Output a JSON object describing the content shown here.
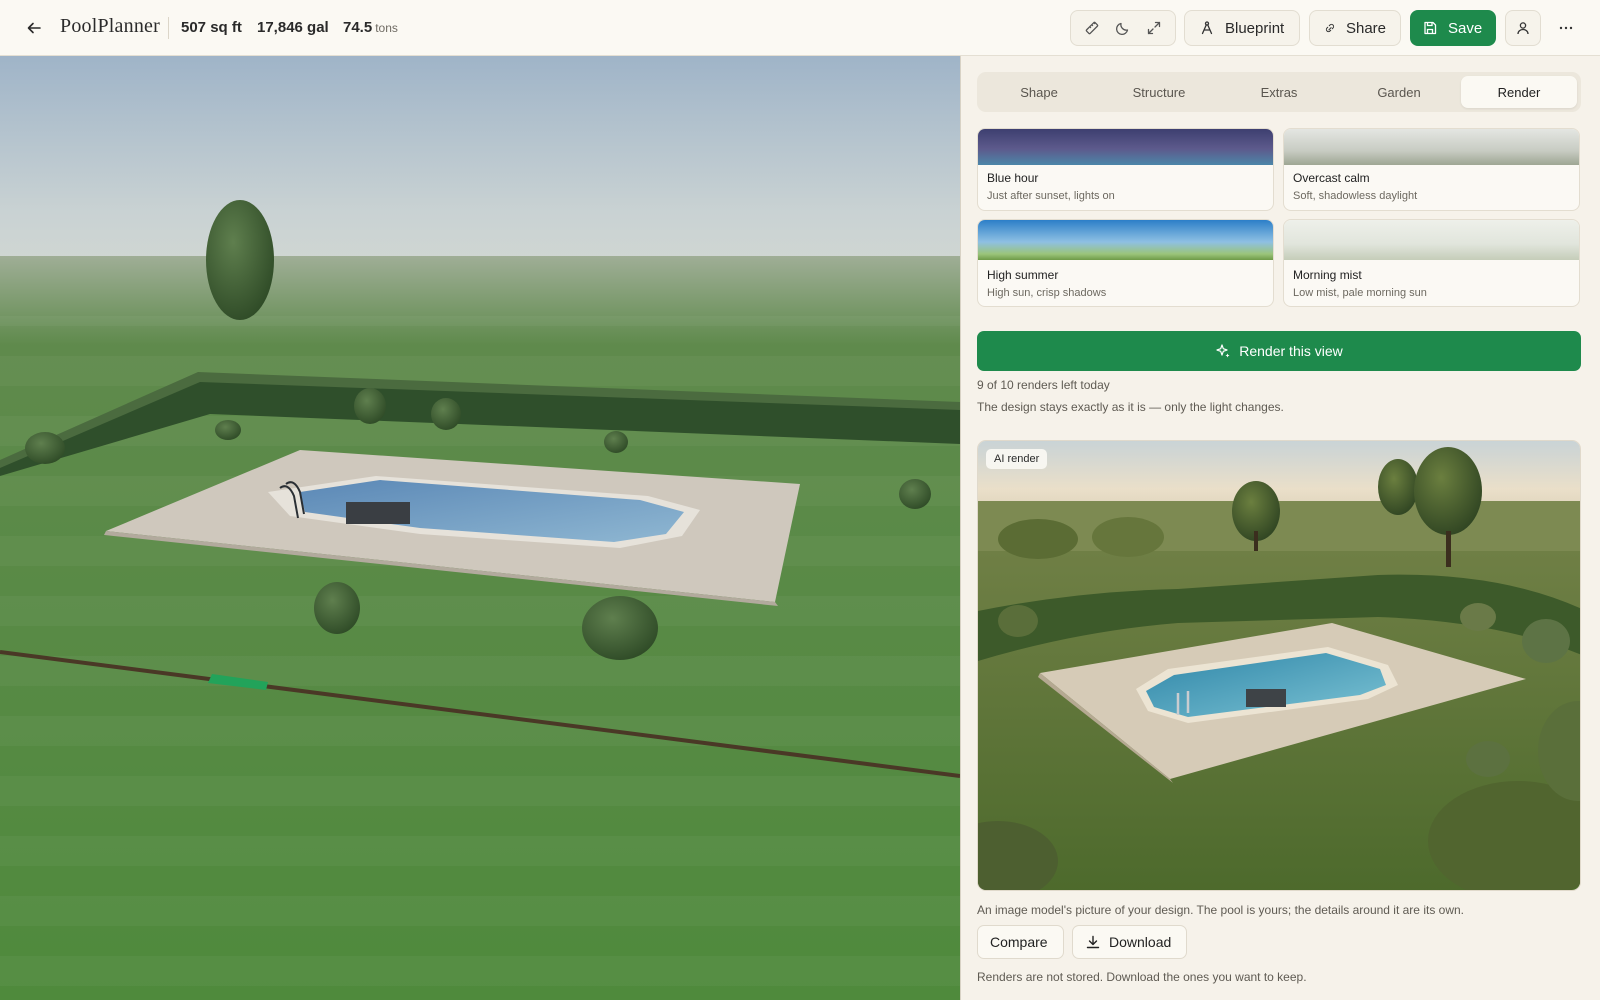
{
  "header": {
    "brand": "PoolPlanner",
    "area": "507 sq ft",
    "volume": "17,846 gal",
    "weight_value": "74.5",
    "weight_unit": "tons",
    "blueprint_label": "Blueprint",
    "share_label": "Share",
    "save_label": "Save",
    "tool_icons": [
      "measure-icon",
      "moon-icon",
      "expand-icon"
    ]
  },
  "tabs": [
    {
      "label": "Shape",
      "active": false
    },
    {
      "label": "Structure",
      "active": false
    },
    {
      "label": "Extras",
      "active": false
    },
    {
      "label": "Garden",
      "active": false
    },
    {
      "label": "Render",
      "active": true
    }
  ],
  "presets": [
    {
      "name": "Blue hour",
      "description": "Just after sunset, lights on"
    },
    {
      "name": "Overcast calm",
      "description": "Soft, shadowless daylight"
    },
    {
      "name": "High summer",
      "description": "High sun, crisp shadows"
    },
    {
      "name": "Morning mist",
      "description": "Low mist, pale morning sun"
    }
  ],
  "render": {
    "button_label": "Render this view",
    "quota": "9 of 10 renders left today",
    "explanation": "The design stays exactly as it is — only the light changes.",
    "badge": "AI render",
    "caption": "An image model's picture of your design. The pool is yours; the details around it are its own.",
    "compare_label": "Compare",
    "download_label": "Download",
    "storage_note": "Renders are not stored. Download the ones you want to keep."
  },
  "colors": {
    "accent": "#1e8a4c",
    "background": "#f7f4ec"
  }
}
